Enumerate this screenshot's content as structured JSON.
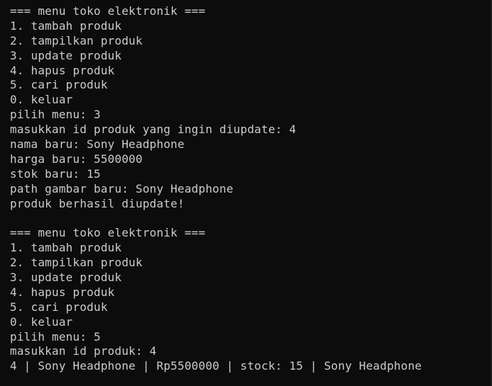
{
  "terminal": {
    "lines": [
      "=== menu toko elektronik ===",
      "1. tambah produk",
      "2. tampilkan produk",
      "3. update produk",
      "4. hapus produk",
      "5. cari produk",
      "0. keluar",
      "pilih menu: 3",
      "masukkan id produk yang ingin diupdate: 4",
      "nama baru: Sony Headphone",
      "harga baru: 5500000",
      "stok baru: 15",
      "path gambar baru: Sony Headphone",
      "produk berhasil diupdate!",
      "",
      "=== menu toko elektronik ===",
      "1. tambah produk",
      "2. tampilkan produk",
      "3. update produk",
      "4. hapus produk",
      "5. cari produk",
      "0. keluar",
      "pilih menu: 5",
      "masukkan id produk: 4",
      "4 | Sony Headphone | Rp5500000 | stock: 15 | Sony Headphone"
    ]
  }
}
